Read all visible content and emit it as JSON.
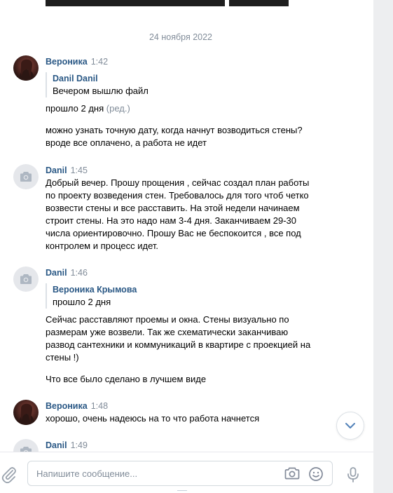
{
  "date_separator": "24 ноября 2022",
  "messages": [
    {
      "author": "Вероника",
      "time": "1:42",
      "forwarded": {
        "author": "Danil Danil",
        "text": "Вечером вышлю файл"
      },
      "reply": "прошло 2 дня",
      "edited": "(ред.)",
      "text": "можно узнать точную дату, когда начнут возводиться стены? вроде все оплачено, а работа не идет"
    },
    {
      "author": "Danil",
      "time": "1:45",
      "text": "Добрый вечер. Прошу прощения , сейчас создал план работы по проекту возведения стен. Требовалось для того чтоб четко возвести стены и все расставить. На этой недели начинаем строит стены. На это надо нам 3-4 дня. Заканчиваем 29-30 числа ориентировочно. Прошу Вас не беспокоится , все под контролем и процесс идет."
    },
    {
      "author": "Danil",
      "time": "1:46",
      "forwarded": {
        "author": "Вероника Крымова",
        "text": "прошло 2 дня"
      },
      "text": "Сейчас расставляют проемы и окна. Стены визуально по размерам уже возвели. Так же схематически заканчиваю развод сантехники и коммуникаций в квартире с проекцией на стены !)",
      "text2": "Что все было сделано в лучшем виде"
    },
    {
      "author": "Вероника",
      "time": "1:48",
      "text": "хорошо, очень надеюсь на то что работа начнется"
    },
    {
      "author": "Danil",
      "time": "1:49"
    }
  ],
  "composer": {
    "placeholder": "Напишите сообщение...",
    "attach_icon": "paperclip-icon",
    "camera_icon": "camera-icon",
    "emoji_icon": "smile-icon",
    "voice_icon": "microphone-icon"
  },
  "scroll_down_icon": "chevron-down-icon",
  "colors": {
    "author": "#2a5885",
    "meta": "#818c99",
    "background": "#edeef0",
    "panel": "#ffffff",
    "quote_bar": "#dce1e6"
  }
}
